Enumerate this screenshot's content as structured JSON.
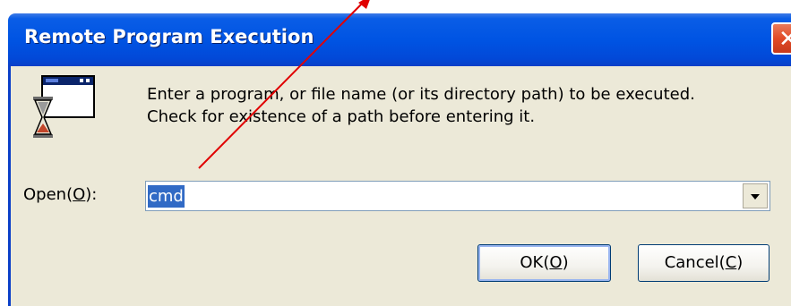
{
  "window": {
    "title": "Remote Program Execution",
    "close_symbol": "✕"
  },
  "instruction": {
    "line1": "Enter a program, or file name (or its directory path) to be executed.",
    "line2": "Check for existence of a path before entering it."
  },
  "open_field": {
    "label_prefix": "Open(",
    "label_key": "O",
    "label_suffix": "):",
    "value": "cmd",
    "selected": true
  },
  "buttons": {
    "ok_prefix": "OK(",
    "ok_key": "O",
    "ok_suffix": ")",
    "cancel_prefix": "Cancel(",
    "cancel_key": "C",
    "cancel_suffix": ")"
  },
  "icons": {
    "app": "program-window-hourglass-icon",
    "dropdown": "chevron-down-icon",
    "close": "close-icon"
  },
  "colors": {
    "titlebar": "#0054e3",
    "dialog_face": "#ece9d8",
    "selection": "#316ac5",
    "annotation_arrow": "#e00000",
    "close_button": "#e24a27"
  }
}
